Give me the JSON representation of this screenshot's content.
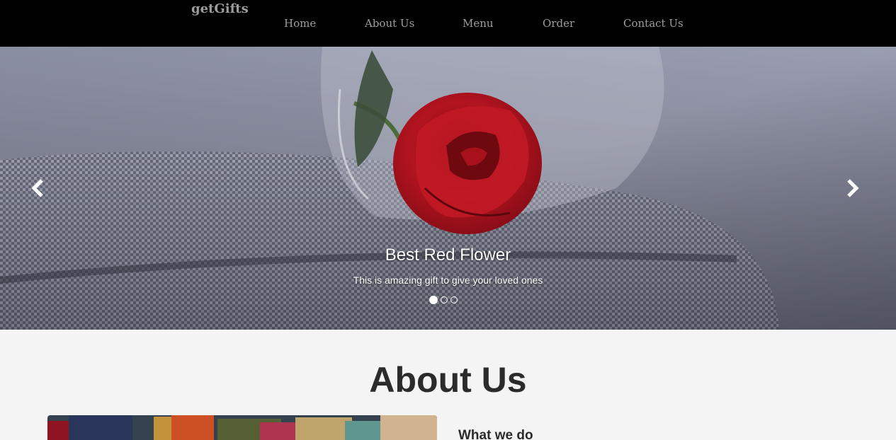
{
  "navbar": {
    "brand": "getGifts",
    "links": [
      "Home",
      "About Us",
      "Menu",
      "Order",
      "Contact Us"
    ]
  },
  "carousel": {
    "slide_title": "Best Red Flower",
    "slide_text": "This is amazing gift to give your loved ones",
    "slide_count": 3,
    "active_slide": 1,
    "prev_icon": "chevron-left-icon",
    "next_icon": "chevron-right-icon"
  },
  "about": {
    "heading": "About Us",
    "subheading": "What we do"
  },
  "colors": {
    "navbar_bg": "#000000",
    "nav_text": "#9d9d9d",
    "page_bg": "#f4f4f4",
    "heading_text": "#2b2b2b",
    "rose": "#b3141f",
    "fabric": "#7f8397"
  }
}
